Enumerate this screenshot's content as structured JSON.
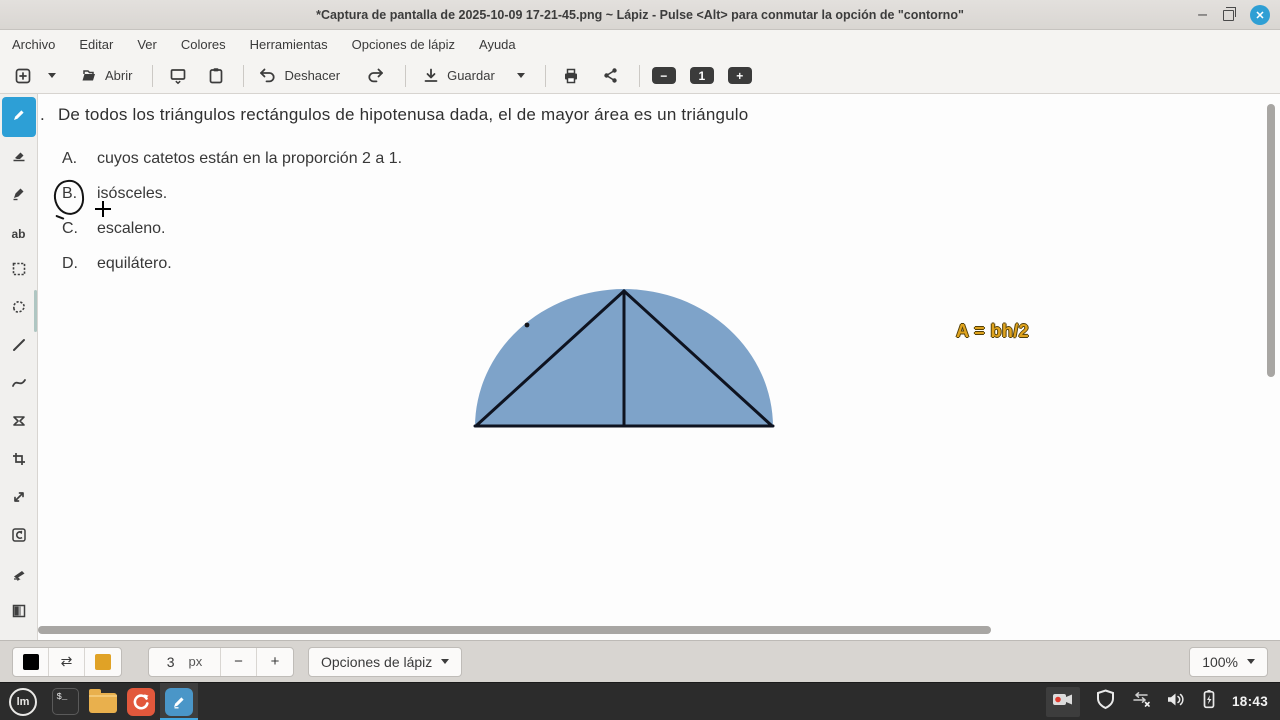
{
  "window": {
    "title": "*Captura de pantalla de 2025-10-09 17-21-45.png ~ Lápiz - Pulse <Alt> para conmutar la opción de \"contorno\"",
    "controls": {
      "minimize": "–",
      "close": "✕"
    }
  },
  "menubar": {
    "items": [
      "Archivo",
      "Editar",
      "Ver",
      "Colores",
      "Herramientas",
      "Opciones de lápiz",
      "Ayuda"
    ]
  },
  "toolbar": {
    "open_label": "Abrir",
    "undo_label": "Deshacer",
    "save_label": "Guardar",
    "zoom_out": "−",
    "zoom_page_badge": "1",
    "zoom_in": "+"
  },
  "sidebar_tools": {
    "selected": "pencil",
    "selected_color": "#2d9fd6",
    "text_tool_glyph": "ab",
    "items": [
      "pencil",
      "eraser",
      "highlighter",
      "text",
      "rect-select",
      "free-select",
      "line",
      "curve",
      "shape",
      "crop",
      "scale",
      "rotate",
      "skew",
      "gradient"
    ]
  },
  "canvas": {
    "question_number": ".",
    "question_text": "De todos los triángulos rectángulos de hipotenusa dada, el de mayor área es un triángulo",
    "options": [
      {
        "letter": "A.",
        "text": "cuyos catetos están en la proporción 2 a 1."
      },
      {
        "letter": "B.",
        "text": "isósceles."
      },
      {
        "letter": "C.",
        "text": "escaleno."
      },
      {
        "letter": "D.",
        "text": "equilátero."
      }
    ],
    "annotation": {
      "circled_option": "B"
    },
    "figure": {
      "description": "semicircle with inscribed triangle and altitude to the diameter",
      "fill_color": "#7ea3c9",
      "line_color": "#0e1320"
    },
    "formula": {
      "text": "A = bh/2",
      "color": "#dfa31e"
    }
  },
  "options_bar": {
    "primary_color": "#000000",
    "swap_glyph": "⇄",
    "secondary_color": "#e0a226",
    "size_value": "3",
    "size_unit": "px",
    "decrease": "−",
    "increase": "+",
    "pencil_options_label": "Opciones de lápiz",
    "zoom_value": "100%"
  },
  "taskbar": {
    "mint_glyph": "lm",
    "terminal_glyph": "$_",
    "clock": "18:43"
  }
}
